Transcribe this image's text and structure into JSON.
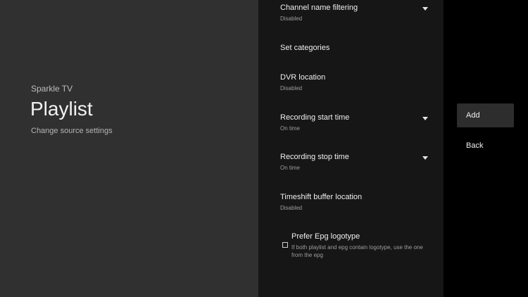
{
  "header": {
    "app_name": "Sparkle TV",
    "title": "Playlist",
    "subtitle": "Change source settings"
  },
  "settings": [
    {
      "title": "Channel name filtering",
      "value": "Disabled",
      "dropdown": true
    },
    {
      "title": "Set categories",
      "value": "",
      "dropdown": false
    },
    {
      "title": "DVR location",
      "value": "Disabled",
      "dropdown": false
    },
    {
      "title": "Recording start time",
      "value": "On time",
      "dropdown": true
    },
    {
      "title": "Recording stop time",
      "value": "On time",
      "dropdown": true
    },
    {
      "title": "Timeshift buffer location",
      "value": "Disabled",
      "dropdown": false
    }
  ],
  "checkbox_setting": {
    "title": "Prefer Epg logotype",
    "description": "If both playlist and epg contain logotype, use the one from the epg",
    "checked": false
  },
  "actions": {
    "add": "Add",
    "back": "Back"
  }
}
